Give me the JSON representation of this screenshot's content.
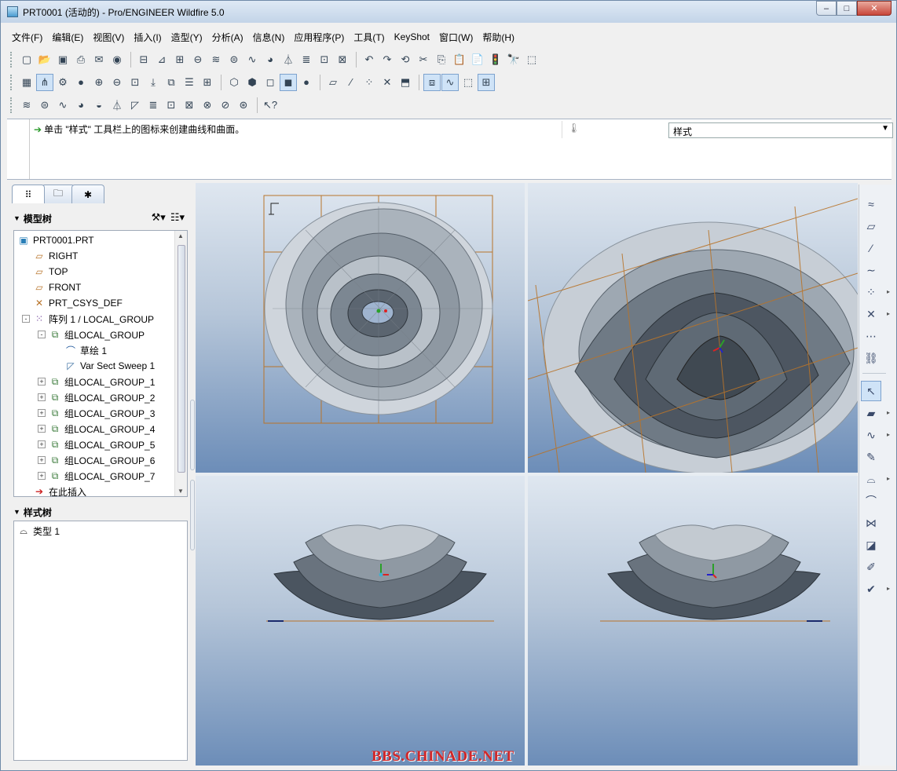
{
  "window": {
    "title": "PRT0001 (活动的) - Pro/ENGINEER Wildfire 5.0",
    "controls": [
      "–",
      "□",
      "✕"
    ]
  },
  "menu": [
    "文件(F)",
    "编辑(E)",
    "视图(V)",
    "插入(I)",
    "造型(Y)",
    "分析(A)",
    "信息(N)",
    "应用程序(P)",
    "工具(T)",
    "KeyShot",
    "窗口(W)",
    "帮助(H)"
  ],
  "message": {
    "text": "单击 \"样式\" 工具栏上的图标来创建曲线和曲面。",
    "filter_value": "样式"
  },
  "left_panel": {
    "model_tree_title": "模型树",
    "style_tree_title": "样式树",
    "model_tree": [
      {
        "label": "PRT0001.PRT",
        "icon": "part-icon",
        "indent": 0
      },
      {
        "label": "RIGHT",
        "icon": "datum-plane-icon",
        "indent": 1
      },
      {
        "label": "TOP",
        "icon": "datum-plane-icon",
        "indent": 1
      },
      {
        "label": "FRONT",
        "icon": "datum-plane-icon",
        "indent": 1
      },
      {
        "label": "PRT_CSYS_DEF",
        "icon": "coordinate-system-icon",
        "indent": 1
      },
      {
        "label": "阵列 1 / LOCAL_GROUP",
        "icon": "pattern-icon",
        "indent": 1,
        "expander": "-"
      },
      {
        "label": "组LOCAL_GROUP",
        "icon": "group-icon",
        "indent": 2,
        "expander": "-"
      },
      {
        "label": "草绘 1",
        "icon": "sketch-icon",
        "indent": 3
      },
      {
        "label": "Var Sect Sweep 1",
        "icon": "sweep-icon",
        "indent": 3
      },
      {
        "label": "组LOCAL_GROUP_1",
        "icon": "group-icon",
        "indent": 2,
        "expander": "+"
      },
      {
        "label": "组LOCAL_GROUP_2",
        "icon": "group-icon",
        "indent": 2,
        "expander": "+"
      },
      {
        "label": "组LOCAL_GROUP_3",
        "icon": "group-icon",
        "indent": 2,
        "expander": "+"
      },
      {
        "label": "组LOCAL_GROUP_4",
        "icon": "group-icon",
        "indent": 2,
        "expander": "+"
      },
      {
        "label": "组LOCAL_GROUP_5",
        "icon": "group-icon",
        "indent": 2,
        "expander": "+"
      },
      {
        "label": "组LOCAL_GROUP_6",
        "icon": "group-icon",
        "indent": 2,
        "expander": "+"
      },
      {
        "label": "组LOCAL_GROUP_7",
        "icon": "group-icon",
        "indent": 2,
        "expander": "+"
      },
      {
        "label": "在此插入",
        "icon": "insert-here-icon",
        "indent": 1
      }
    ],
    "style_tree": [
      {
        "label": "类型 1",
        "icon": "style-type-icon"
      }
    ]
  },
  "viewports": [
    {
      "name": "viewport-top",
      "view": "top"
    },
    {
      "name": "viewport-3d",
      "view": "perspective"
    },
    {
      "name": "viewport-front",
      "view": "front"
    },
    {
      "name": "viewport-right",
      "view": "side"
    }
  ],
  "watermark": "BBS.CHINADE.NET",
  "colors": {
    "grid": "#b8742a",
    "model": "#5b6570",
    "viewport_top": "#dfe7f0",
    "viewport_bottom": "#6c8db8"
  }
}
